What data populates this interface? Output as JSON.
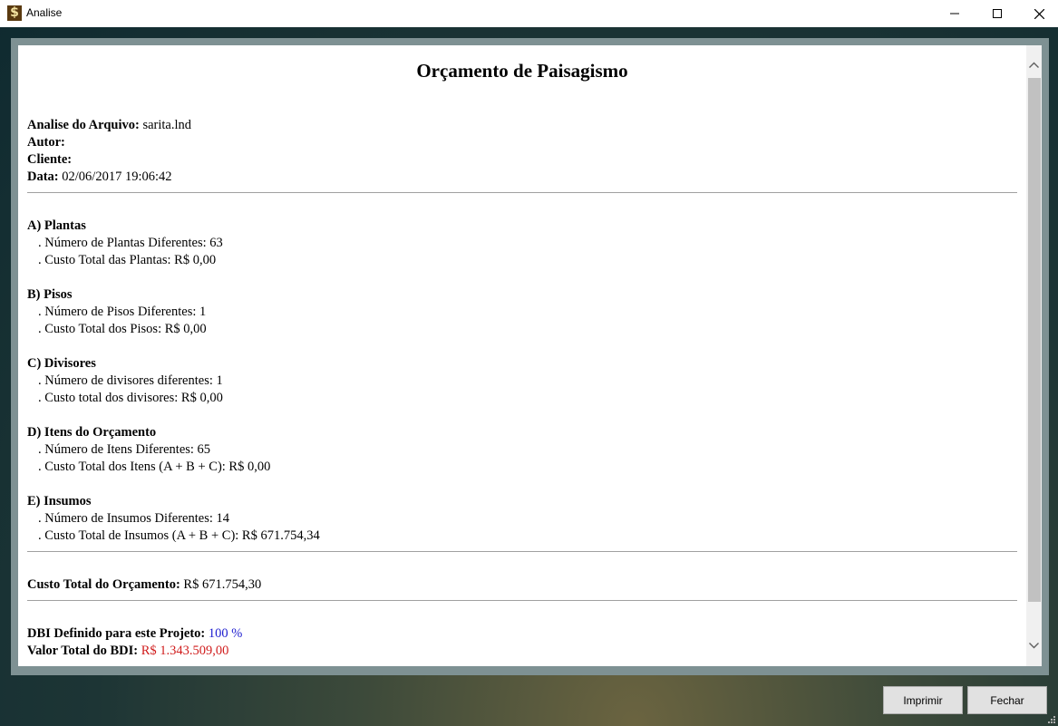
{
  "window": {
    "title": "Analise",
    "icon": "dollar-icon"
  },
  "report": {
    "title": "Orçamento de Paisagismo",
    "file_label": "Analise do Arquivo:",
    "file_value": "sarita.lnd",
    "author_label": "Autor:",
    "client_label": "Cliente:",
    "date_label": "Data:",
    "date_value": "02/06/2017 19:06:42",
    "sections": [
      {
        "heading": "A) Plantas",
        "line1": ". Número de Plantas Diferentes: 63",
        "line2": ". Custo Total das Plantas: R$ 0,00"
      },
      {
        "heading": "B) Pisos",
        "line1": ". Número de Pisos Diferentes: 1",
        "line2": ". Custo Total dos Pisos: R$ 0,00"
      },
      {
        "heading": "C) Divisores",
        "line1": ". Número de divisores diferentes: 1",
        "line2": ". Custo total dos divisores: R$ 0,00"
      },
      {
        "heading": "D) Itens do Orçamento",
        "line1": ". Número de Itens Diferentes: 65",
        "line2": ". Custo Total dos Itens (A + B + C): R$ 0,00"
      },
      {
        "heading": "E) Insumos",
        "line1": ". Número de Insumos Diferentes: 14",
        "line2": ". Custo Total de Insumos (A + B + C): R$ 671.754,34"
      }
    ],
    "total_label": "Custo Total do Orçamento:",
    "total_value": "R$ 671.754,30",
    "dbi_label": "DBI Definido para este Projeto:",
    "dbi_value": "100 %",
    "bdi_label": "Valor Total do BDI:",
    "bdi_value": "R$ 1.343.509,00"
  },
  "buttons": {
    "print": "Imprimir",
    "close": "Fechar"
  },
  "colors": {
    "dbi": "#1c1ccf",
    "bdi": "#d01c1c"
  }
}
